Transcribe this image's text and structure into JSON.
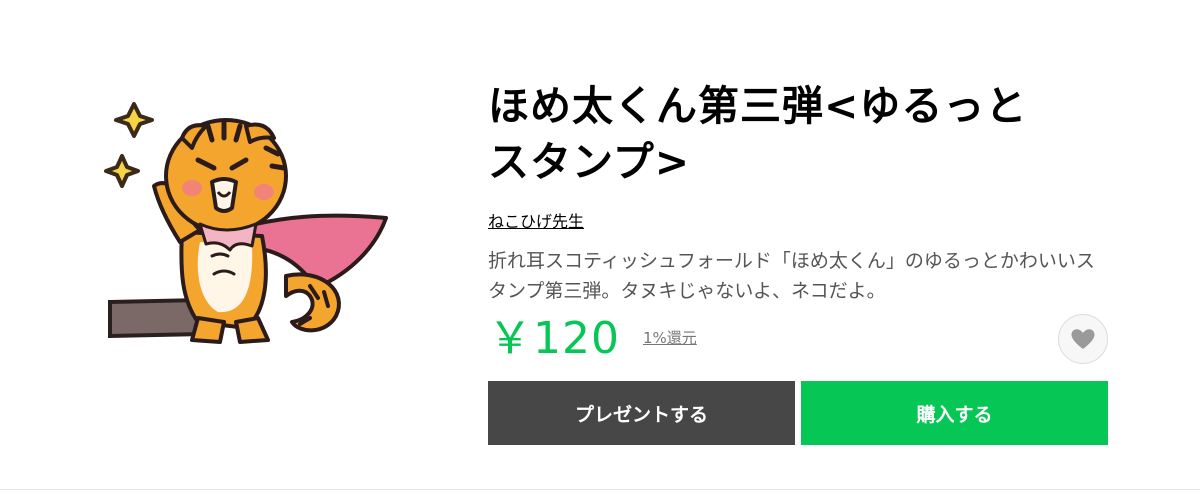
{
  "product": {
    "title_line1": "ほめ太くん第三弾<ゆるっと",
    "title_line2": "スタンプ>",
    "author": "ねこひげ先生",
    "description": "折れ耳スコティッシュフォールド「ほめ太くん」のゆるっとかわいいスタンプ第三弾。タヌキじゃないよ、ネコだよ。"
  },
  "pricing": {
    "price": "￥120",
    "cashback": "1%還元"
  },
  "actions": {
    "gift_label": "プレゼントする",
    "buy_label": "購入する"
  },
  "icons": {
    "sticker": "tabby-cat-hero-sticker",
    "favorite": "heart-icon"
  },
  "colors": {
    "accent": "#06c755",
    "gift_button": "#474747",
    "favorite_icon": "#9a9a9a"
  }
}
